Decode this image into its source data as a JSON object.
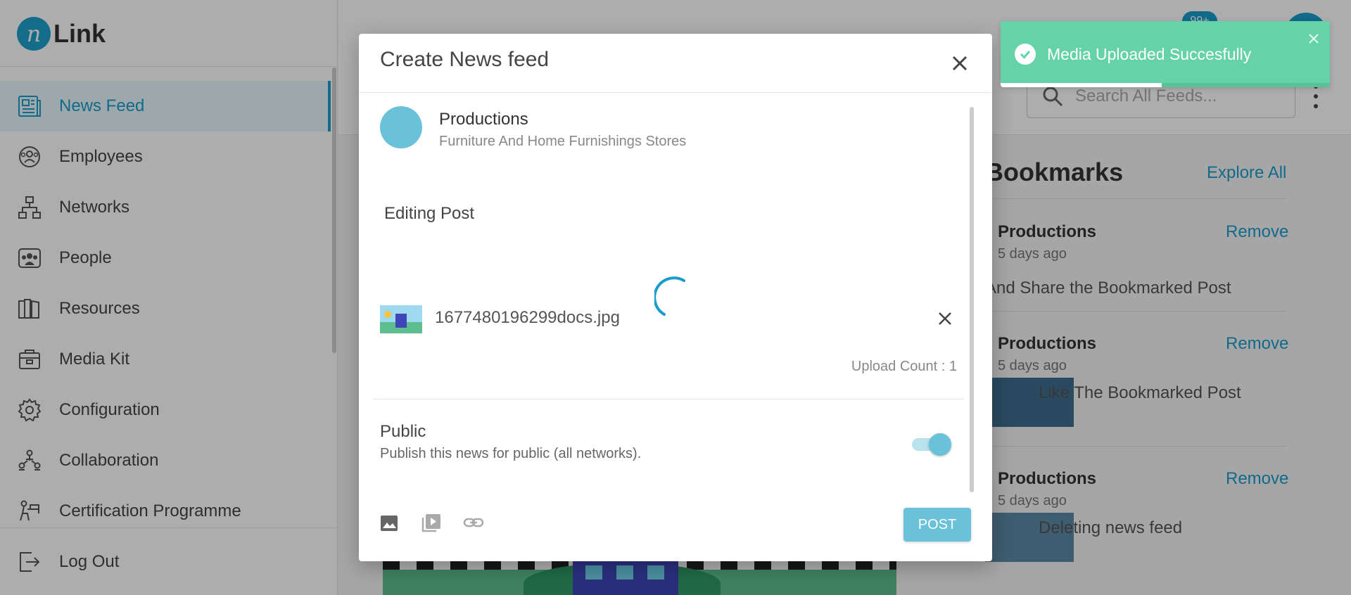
{
  "app": {
    "logo_letter": "n",
    "logo_text": "Link",
    "notification_count": "99+"
  },
  "sidebar": {
    "items": [
      {
        "label": "News Feed",
        "icon": "news-feed-icon",
        "active": true
      },
      {
        "label": "Employees",
        "icon": "employees-icon"
      },
      {
        "label": "Networks",
        "icon": "networks-icon"
      },
      {
        "label": "People",
        "icon": "people-icon"
      },
      {
        "label": "Resources",
        "icon": "resources-icon"
      },
      {
        "label": "Media Kit",
        "icon": "media-kit-icon"
      },
      {
        "label": "Configuration",
        "icon": "gear-icon"
      },
      {
        "label": "Collaboration",
        "icon": "collaboration-icon"
      },
      {
        "label": "Certification Programme",
        "icon": "certification-icon"
      }
    ],
    "logout_label": "Log Out"
  },
  "search": {
    "placeholder": "Search All Feeds..."
  },
  "bookmarks": {
    "title": "Bookmarks",
    "explore_label": "Explore All",
    "items": [
      {
        "name": "Productions",
        "time": "5 days ago",
        "remove": "Remove",
        "text": "And Share the Bookmarked Post"
      },
      {
        "name": "Productions",
        "time": "5 days ago",
        "remove": "Remove",
        "text": "Like The Bookmarked Post"
      },
      {
        "name": "Productions",
        "time": "5 days ago",
        "remove": "Remove",
        "text": "Deleting news feed"
      }
    ]
  },
  "modal": {
    "title": "Create News feed",
    "author": {
      "name": "Productions",
      "subtitle": "Furniture And Home Furnishings Stores"
    },
    "post_text": "Editing Post",
    "file": {
      "name": "1677480196299docs.jpg"
    },
    "upload_count_label": "Upload Count : 1",
    "public": {
      "title": "Public",
      "description": "Publish this news for public (all networks).",
      "enabled": true
    },
    "tools": [
      "image-icon",
      "video-icon",
      "link-icon"
    ],
    "post_label": "POST"
  },
  "toast": {
    "message": "Media Uploaded Succesfully",
    "progress": 0.49
  },
  "colors": {
    "accent": "#1a9dcc",
    "toast": "#65d2a8",
    "post_button": "#6ac2da"
  }
}
